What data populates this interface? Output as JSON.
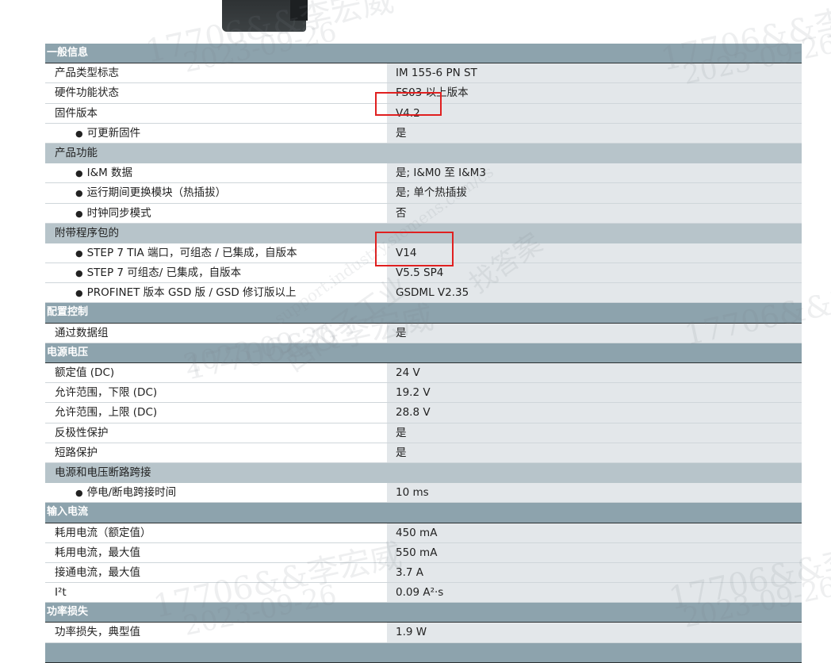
{
  "sections": [
    {
      "type": "section",
      "label": "一般信息"
    },
    {
      "type": "item",
      "label": "产品类型标志",
      "value": "IM 155-6 PN ST"
    },
    {
      "type": "item",
      "label": "硬件功能状态",
      "value": "FS03 以上版本"
    },
    {
      "type": "item",
      "label": "固件版本",
      "value": "V4.2",
      "highlight": true
    },
    {
      "type": "item",
      "label": "可更新固件",
      "value": "是",
      "indent": true
    },
    {
      "type": "subhead",
      "label": "产品功能"
    },
    {
      "type": "item",
      "label": "I&M 数据",
      "value": "是; I&M0 至 I&M3",
      "indent": true
    },
    {
      "type": "item",
      "label": "运行期间更换模块（热插拔）",
      "value": "是; 单个热插拔",
      "indent": true
    },
    {
      "type": "item",
      "label": "时钟同步模式",
      "value": "否",
      "indent": true
    },
    {
      "type": "subhead",
      "label": "附带程序包的"
    },
    {
      "type": "item",
      "label": "STEP 7 TIA 端口，可组态 / 已集成，自版本",
      "value": "V14",
      "indent": true,
      "highlight": true
    },
    {
      "type": "item",
      "label": "STEP 7 可组态/ 已集成，自版本",
      "value": "V5.5 SP4",
      "indent": true
    },
    {
      "type": "item",
      "label": "PROFINET 版本 GSD 版 / GSD 修订版以上",
      "value": "GSDML V2.35",
      "indent": true
    },
    {
      "type": "section",
      "label": "配置控制"
    },
    {
      "type": "item",
      "label": "通过数据组",
      "value": "是"
    },
    {
      "type": "section",
      "label": "电源电压"
    },
    {
      "type": "item",
      "label": "额定值 (DC)",
      "value": "24 V"
    },
    {
      "type": "item",
      "label": "允许范围，下限 (DC)",
      "value": "19.2 V"
    },
    {
      "type": "item",
      "label": "允许范围，上限 (DC)",
      "value": "28.8 V"
    },
    {
      "type": "item",
      "label": "反极性保护",
      "value": "是"
    },
    {
      "type": "item",
      "label": "短路保护",
      "value": "是"
    },
    {
      "type": "subhead",
      "label": "电源和电压断路跨接"
    },
    {
      "type": "item",
      "label": "停电/断电跨接时间",
      "value": "10 ms",
      "indent": true
    },
    {
      "type": "section",
      "label": "输入电流"
    },
    {
      "type": "item",
      "label": "耗用电流（额定值）",
      "value": "450 mA"
    },
    {
      "type": "item",
      "label": "耗用电流，最大值",
      "value": "550 mA"
    },
    {
      "type": "item",
      "label": "接通电流，最大值",
      "value": "3.7 A"
    },
    {
      "type": "item",
      "label": "I²t",
      "value": "0.09 A²·s"
    },
    {
      "type": "section",
      "label": "功率损失"
    },
    {
      "type": "item",
      "label": "功率损失，典型值",
      "value": "1.9 W"
    },
    {
      "type": "section",
      "label": ""
    }
  ],
  "bullet_glyph": "●",
  "watermarks": [
    "17706&&李宏威",
    "2023-09-26",
    "西门子工业",
    "support.industry.siemens.com/cs",
    "找答案"
  ],
  "colors": {
    "section_bg": "#8da3ad",
    "subhead_bg": "#b7c4ca",
    "value_bg": "#e3e7ea",
    "highlight": "#e02020"
  }
}
